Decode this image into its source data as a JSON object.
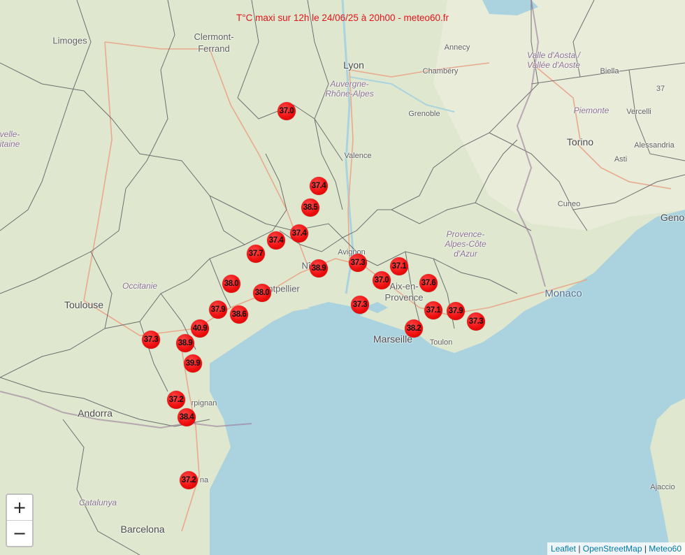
{
  "title": "T°C maxi sur 12h le 24/06/25 à 20h00 - meteo60.fr",
  "colors": {
    "land": "#dfe8cf",
    "sea": "#aad3df",
    "marker": "#f01010",
    "title": "#e0141b"
  },
  "markers": [
    {
      "label": "37.0"
    },
    {
      "label": "37.4"
    },
    {
      "label": "38.5"
    },
    {
      "label": "37.4"
    },
    {
      "label": "37.4"
    },
    {
      "label": "37.7"
    },
    {
      "label": "38.9"
    },
    {
      "label": "37.3"
    },
    {
      "label": "37.1"
    },
    {
      "label": "37.0"
    },
    {
      "label": "37.6"
    },
    {
      "label": "38.0"
    },
    {
      "label": "38.0"
    },
    {
      "label": "37.9"
    },
    {
      "label": "38.6"
    },
    {
      "label": "37.3"
    },
    {
      "label": "37.1"
    },
    {
      "label": "37.9"
    },
    {
      "label": "37.3"
    },
    {
      "label": "40.9"
    },
    {
      "label": "37.3"
    },
    {
      "label": "38.9"
    },
    {
      "label": "38.2"
    },
    {
      "label": "39.9"
    },
    {
      "label": "37.2"
    },
    {
      "label": "38.4"
    },
    {
      "label": "37.2"
    }
  ],
  "places": {
    "limoges": "Limoges",
    "clermont": "Clermont-\nFerrand",
    "lyon": "Lyon",
    "aura": "Auvergne-\nRhône-Alpes",
    "annecy": "Annecy",
    "chambery": "Chambéry",
    "aoste": "Valle d'Aosta /\nVallée d'Aoste",
    "biella": "Biella",
    "grenoble": "Grenoble",
    "valence": "Valence",
    "piemonte": "Piemonte",
    "vercelli": "Vercelli",
    "torino": "Torino",
    "asti": "Asti",
    "alessandria": "Alessandria",
    "cuneo": "Cuneo",
    "genova": "Geno",
    "paca": "Provence-\nAlpes-Côte\nd'Azur",
    "avignon": "Avignon",
    "nimes": "Nî",
    "montpellier": "ntpellier",
    "occitanie": "Occitanie",
    "toulouse": "Toulouse",
    "aix": "Aix-en-\nProvence",
    "marseille": "Marseille",
    "toulon": "Toulon",
    "monaco": "Monaco",
    "aquitaine": "velle-\nitaine",
    "andorra": "Andorra",
    "perpignan": "rpignan",
    "girona": "na",
    "catalunya": "Catalunya",
    "barcelona": "Barcelona",
    "ajaccio": "Ajaccio",
    "b37": "37"
  },
  "controls": {
    "zoom_in": "+",
    "zoom_out": "−"
  },
  "attribution": {
    "leaflet": "Leaflet",
    "sep1": " | ",
    "osm": "OpenStreetMap",
    "sep2": " | ",
    "meteo": "Meteo60"
  }
}
